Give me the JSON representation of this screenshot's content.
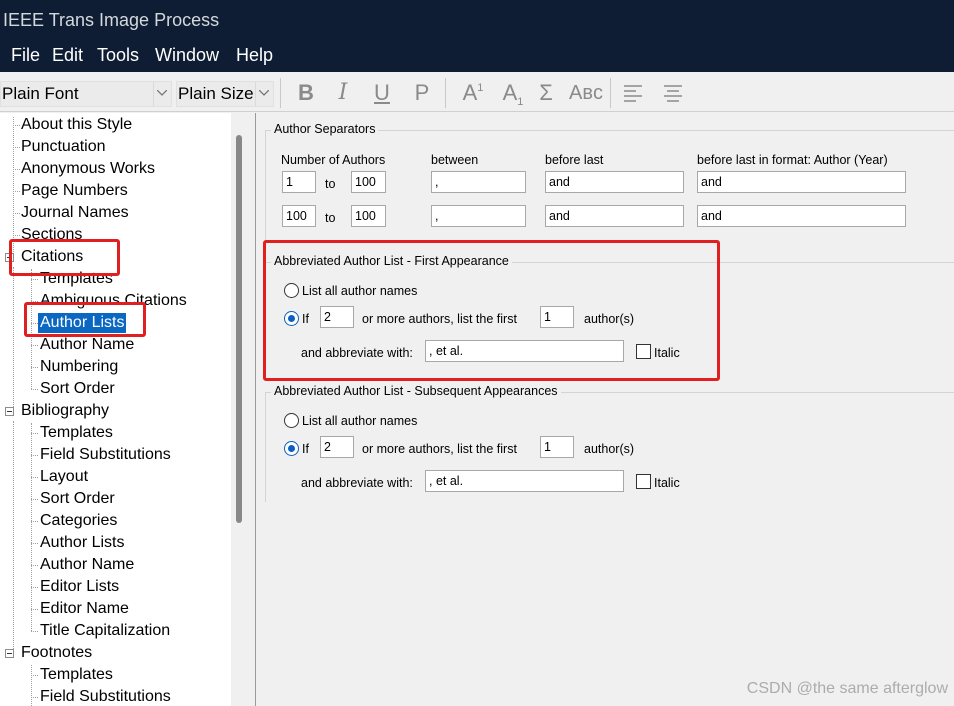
{
  "window": {
    "title": "IEEE Trans Image Process"
  },
  "menu": [
    "File",
    "Edit",
    "Tools",
    "Window",
    "Help"
  ],
  "toolbar": {
    "font_combo": "Plain Font",
    "size_combo": "Plain Size",
    "bold": "B",
    "italic": "I",
    "underline": "U",
    "plain": "P",
    "superscript": "A",
    "superscript_mark": "1",
    "subscript": "A",
    "subscript_mark": "1",
    "symbol": "Σ",
    "smallcaps": "Aʙᴄ"
  },
  "tree": {
    "about": "About this Style",
    "punctuation": "Punctuation",
    "anonymous": "Anonymous Works",
    "page_numbers": "Page Numbers",
    "journal_names": "Journal Names",
    "sections": "Sections",
    "citations": "Citations",
    "cit_templates": "Templates",
    "cit_ambiguous": "Ambiguous Citations",
    "cit_author_lists": "Author Lists",
    "cit_author_name": "Author Name",
    "cit_numbering": "Numbering",
    "cit_sort_order": "Sort Order",
    "bibliography": "Bibliography",
    "bib_templates": "Templates",
    "bib_field_subs": "Field Substitutions",
    "bib_layout": "Layout",
    "bib_sort_order": "Sort Order",
    "bib_categories": "Categories",
    "bib_author_lists": "Author Lists",
    "bib_author_name": "Author Name",
    "bib_editor_lists": "Editor Lists",
    "bib_editor_name": "Editor Name",
    "bib_title_cap": "Title Capitalization",
    "footnotes": "Footnotes",
    "fn_templates": "Templates",
    "fn_field_subs": "Field Substitutions"
  },
  "separators": {
    "legend": "Author Separators",
    "col_number": "Number of Authors",
    "col_between": "between",
    "col_before_last": "before last",
    "col_before_last_format": "before last in format: Author (Year)",
    "to_label": "to",
    "rows": [
      {
        "from": "1",
        "to": "100",
        "between": ",",
        "before_last": "and",
        "before_last_format": "and"
      },
      {
        "from": "100",
        "to": "100",
        "between": ",",
        "before_last": "and",
        "before_last_format": "and"
      }
    ]
  },
  "first": {
    "legend": "Abbreviated Author List - First Appearance",
    "list_all": "List all author names",
    "if_label": "If",
    "if_value": "2",
    "mid_label": "or more authors, list the first",
    "first_value": "1",
    "authors_label": "author(s)",
    "abbrev_label": "and abbreviate with:",
    "abbrev_value": ", et al.",
    "italic_label": "Italic"
  },
  "subsequent": {
    "legend": "Abbreviated Author List - Subsequent Appearances",
    "list_all": "List all author names",
    "if_label": "If",
    "if_value": "2",
    "mid_label": "or more authors, list the first",
    "first_value": "1",
    "authors_label": "author(s)",
    "abbrev_label": "and abbreviate with:",
    "abbrev_value": ", et al.",
    "italic_label": "Italic"
  },
  "watermark": "CSDN @the same afterglow"
}
